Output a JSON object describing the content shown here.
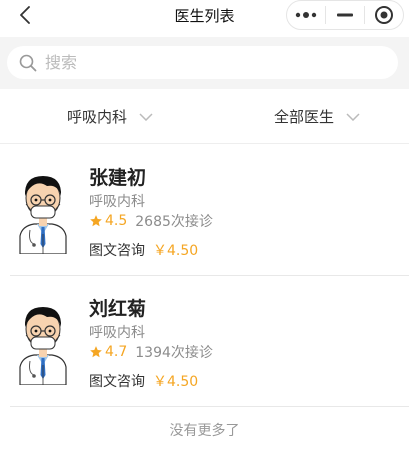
{
  "nav": {
    "title": "医生列表",
    "back_icon": "chevron-left-icon",
    "capsule_icons": [
      "more-dots-icon",
      "minimize-icon",
      "target-circle-icon"
    ]
  },
  "search": {
    "placeholder": "搜索",
    "value": "",
    "icon": "search-icon"
  },
  "filters": {
    "department": "呼吸内科",
    "doctor_type": "全部医生"
  },
  "doctors": [
    {
      "name": "张建初",
      "department": "呼吸内科",
      "rating": "4.5",
      "consultations": "2685次接诊",
      "service": "图文咨询",
      "price": "￥4.50"
    },
    {
      "name": "刘红菊",
      "department": "呼吸内科",
      "rating": "4.7",
      "consultations": "1394次接诊",
      "service": "图文咨询",
      "price": "￥4.50"
    }
  ],
  "footer": {
    "no_more": "没有更多了"
  },
  "colors": {
    "accent": "#f5a623",
    "muted": "#8c8c8c",
    "search_bg": "#f4f4f4"
  }
}
